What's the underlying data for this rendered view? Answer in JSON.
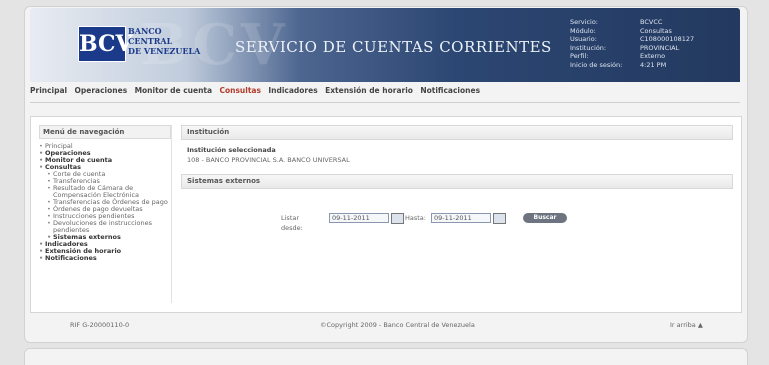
{
  "header": {
    "logo_abbr": "BCV",
    "logo_lines": [
      "BANCO",
      "CENTRAL",
      "DE VENEZUELA"
    ],
    "service_title": "SERVICIO DE CUENTAS CORRIENTES",
    "session_labels": [
      "Servicio:",
      "Módulo:",
      "Usuario:",
      "Institución:",
      "Perfil:",
      "Inicio de sesión:"
    ],
    "session_values": [
      "BCVCC",
      "Consultas",
      "C108000108127",
      "PROVINCIAL",
      "Externo",
      "4:21 PM"
    ]
  },
  "nav": {
    "items": [
      "Principal",
      "Operaciones",
      "Monitor de cuenta",
      "Consultas",
      "Indicadores",
      "Extensión de horario",
      "Notificaciones"
    ],
    "active_index": 3
  },
  "sidebar": {
    "title": "Menú de navegación",
    "items": [
      {
        "label": "Principal",
        "bold": false,
        "sub": false
      },
      {
        "label": "Operaciones",
        "bold": true,
        "sub": false
      },
      {
        "label": "Monitor de cuenta",
        "bold": true,
        "sub": false
      },
      {
        "label": "Consultas",
        "bold": true,
        "sub": false
      },
      {
        "label": "Corte de cuenta",
        "bold": false,
        "sub": true
      },
      {
        "label": "Transferencias",
        "bold": false,
        "sub": true
      },
      {
        "label": "Resultado de Cámara de Compensación Electrónica",
        "bold": false,
        "sub": true
      },
      {
        "label": "Transferencias de Órdenes de pago",
        "bold": false,
        "sub": true
      },
      {
        "label": "Órdenes de pago devueltas",
        "bold": false,
        "sub": true
      },
      {
        "label": "Instrucciones pendientes",
        "bold": false,
        "sub": true
      },
      {
        "label": "Devoluciones de instrucciones pendientes",
        "bold": false,
        "sub": true
      },
      {
        "label": "Sistemas externos",
        "bold": true,
        "sub": true
      },
      {
        "label": "Indicadores",
        "bold": true,
        "sub": false
      },
      {
        "label": "Extensión de horario",
        "bold": true,
        "sub": false
      },
      {
        "label": "Notificaciones",
        "bold": true,
        "sub": false
      }
    ]
  },
  "institution": {
    "section_title": "Institución",
    "selected_label": "Institución seleccionada",
    "selected_value": "108 - BANCO PROVINCIAL S.A. BANCO UNIVERSAL"
  },
  "external": {
    "section_title": "Sistemas externos",
    "from_label": "Listar desde:",
    "from_value": "09-11-2011",
    "to_label": "Hasta:",
    "to_value": "09-11-2011",
    "search_button": "Buscar"
  },
  "footer": {
    "left": "RIF G-20000110-0",
    "center": "©Copyright 2009 - Banco Central de Venezuela",
    "right": "Ir arriba"
  }
}
